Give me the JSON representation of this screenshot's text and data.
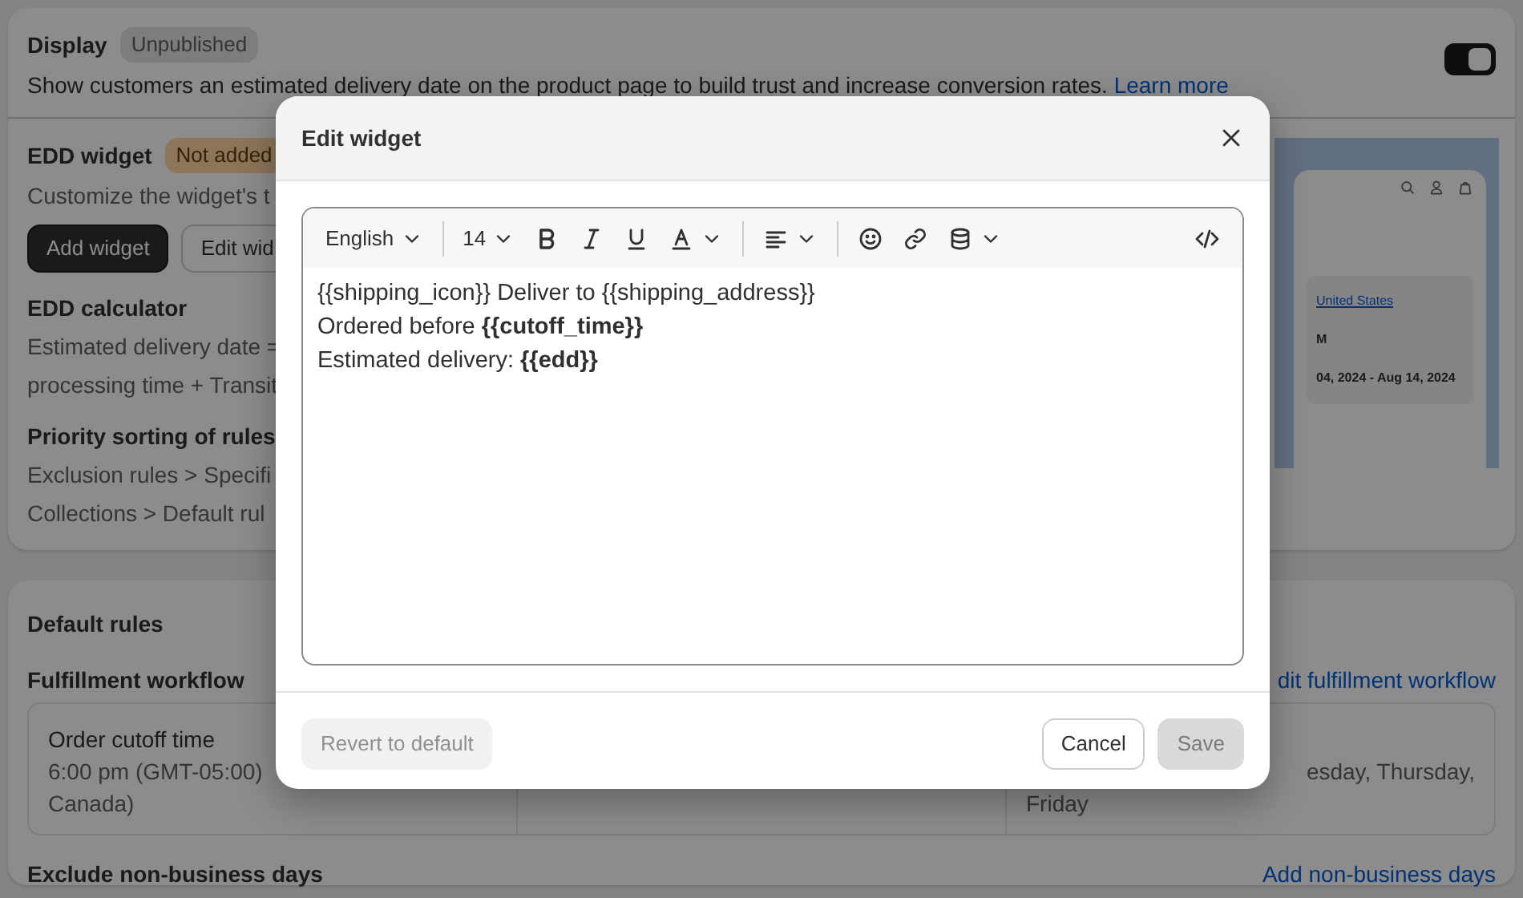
{
  "display": {
    "title": "Display",
    "badge": "Unpublished",
    "toggle_on": true,
    "description": "Show customers an estimated delivery date on the product page to build trust and increase conversion rates.",
    "link": "Learn more"
  },
  "edd_widget": {
    "title": "EDD widget",
    "badge": "Not added",
    "description": "Customize the widget's t",
    "buttons": [
      {
        "label": "Add widget",
        "kind": "primary"
      },
      {
        "label": "Edit wid",
        "kind": "secondary"
      }
    ]
  },
  "sections": [
    {
      "title": "EDD calculator",
      "lines": [
        "Estimated delivery date =",
        "processing time + Transit"
      ]
    },
    {
      "title": "Priority sorting of rules",
      "lines": [
        "Exclusion rules > Specifi",
        "Collections > Default rul"
      ]
    }
  ],
  "preview": {
    "link": "United States",
    "line_2": "M",
    "line_3": "04, 2024 - Aug 14, 2024"
  },
  "default_rules": {
    "title": "Default rules",
    "workflow_label": "Fulfillment workflow",
    "workflow_link": "dit fulfillment workflow",
    "columns": [
      {
        "title": "Order cutoff time",
        "lines": [
          "6:00 pm (GMT-05:00)",
          "Canada)"
        ]
      },
      {
        "lines": [
          "esday, Thursday,",
          "Friday"
        ]
      }
    ],
    "exclude_label": "Exclude non-business days",
    "exclude_link": "Add non-business days"
  },
  "modal": {
    "title": "Edit widget",
    "toolbar": {
      "language": "English",
      "font_size": "14"
    },
    "content": [
      "{{shipping_icon}} Deliver to {{shipping_address}}",
      "Ordered before **{{cutoff_time}}**",
      "Estimated delivery: **{{edd}}**"
    ],
    "buttons": [
      {
        "label": "Revert to default",
        "kind": "ghost",
        "disabled": true
      },
      {
        "label": "Cancel",
        "kind": "secondary",
        "disabled": false
      },
      {
        "label": "Save",
        "kind": "primary",
        "disabled": true
      }
    ]
  }
}
